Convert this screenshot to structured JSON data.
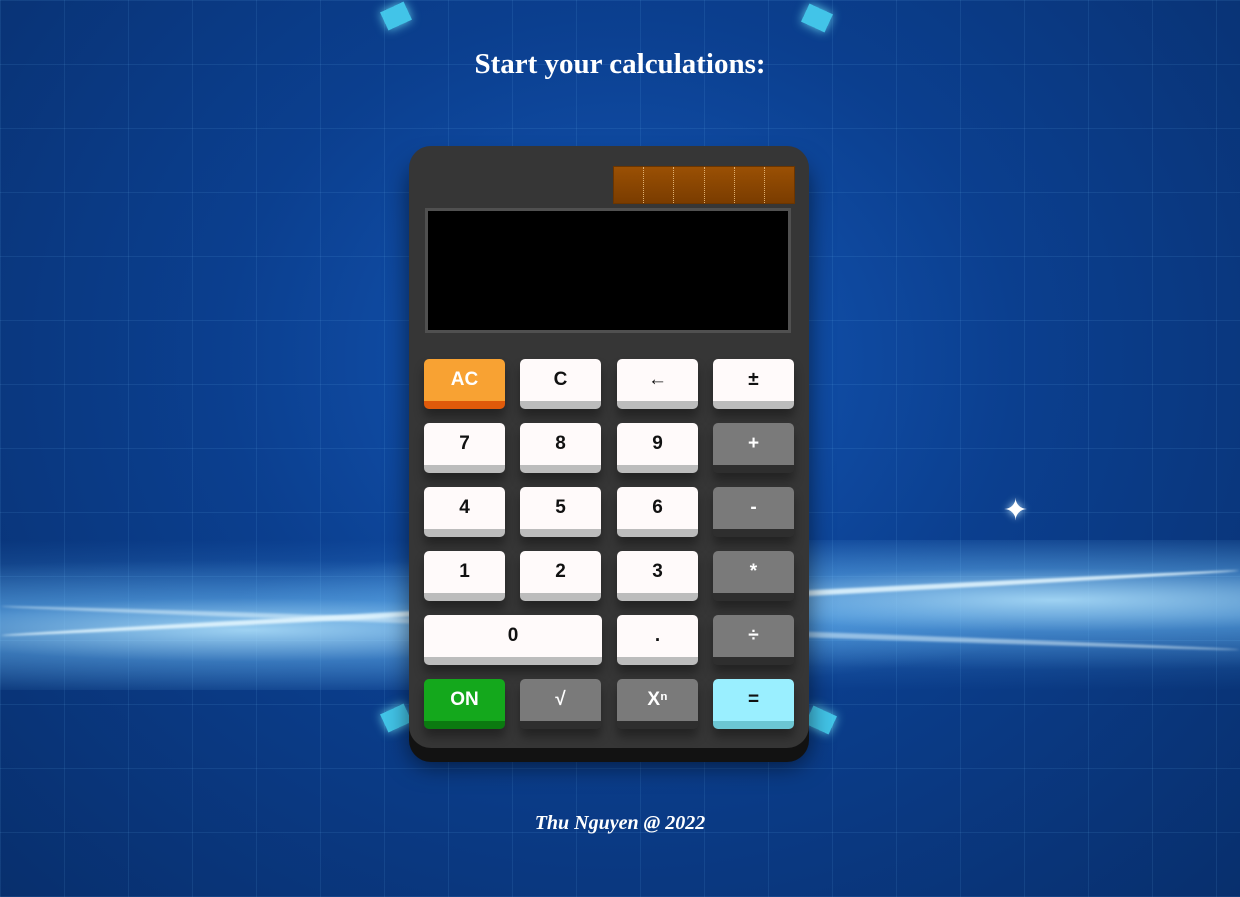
{
  "page": {
    "title": "Start your calculations:",
    "footer": "Thu Nguyen @ 2022"
  },
  "calculator": {
    "display_value": "",
    "solar_panel_cells": 6,
    "keys": {
      "ac": "AC",
      "c": "C",
      "backspace": "←",
      "plus_minus": "±",
      "seven": "7",
      "eight": "8",
      "nine": "9",
      "plus": "+",
      "four": "4",
      "five": "5",
      "six": "6",
      "minus": "-",
      "one": "1",
      "two": "2",
      "three": "3",
      "multiply": "*",
      "zero": "0",
      "decimal": ".",
      "divide": "÷",
      "on": "ON",
      "sqrt": "√",
      "power": "Xⁿ",
      "equals": "="
    }
  },
  "colors": {
    "body": "#363636",
    "white_key": "#fffafa",
    "grey_key": "#7a7a7a",
    "orange_key": "#f8a233",
    "green_key": "#14a81c",
    "cyan_key": "#9aefff",
    "solar_panel": "#8a4500"
  }
}
